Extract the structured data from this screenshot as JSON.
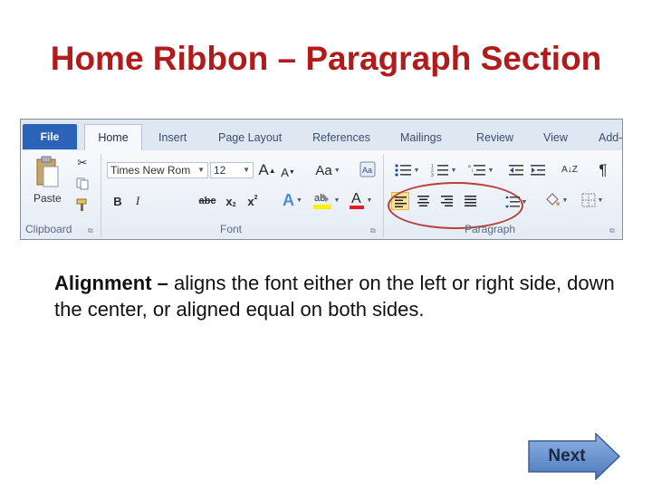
{
  "title": "Home Ribbon – Paragraph Section",
  "ribbon": {
    "tabs": [
      "File",
      "Home",
      "Insert",
      "Page Layout",
      "References",
      "Mailings",
      "Review",
      "View",
      "Add-"
    ],
    "groups": {
      "clipboard": "Clipboard",
      "font": "Font",
      "paragraph": "Paragraph"
    },
    "paste_label": "Paste",
    "font_name": "Times New Rom",
    "font_size": "12",
    "bold": "B",
    "italic": "I",
    "strike": "abc",
    "pilcrow": "¶",
    "sort": "A↓Z"
  },
  "description": {
    "term": "Alignment –",
    "text": " aligns the font either on the left or right side, down the center, or aligned equal on both sides."
  },
  "next_label": "Next",
  "colors": {
    "title": "#b01c1c",
    "accent": "#2a63b8",
    "highlight": "#fde19a",
    "circle": "#b7413a"
  }
}
